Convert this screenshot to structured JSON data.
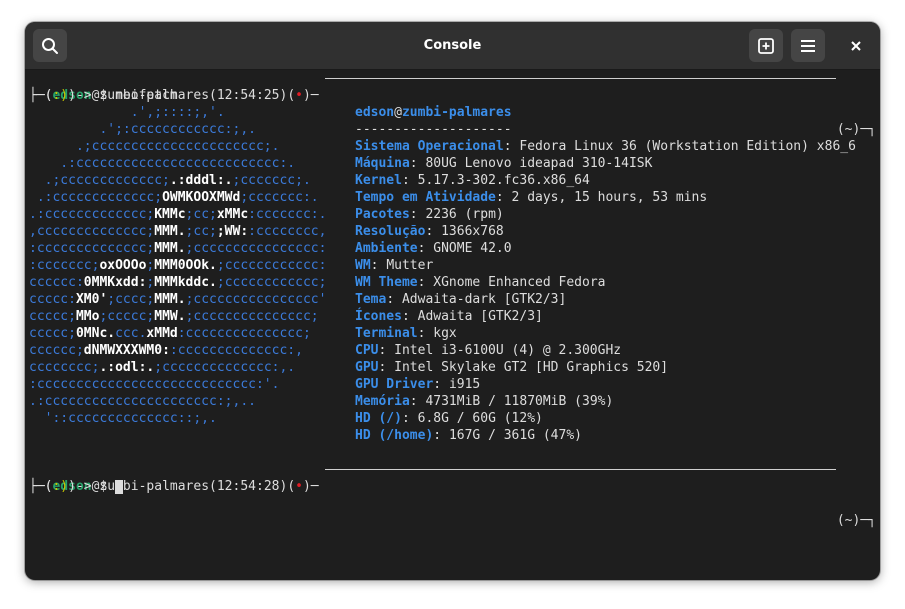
{
  "window": {
    "title": "Console",
    "icons": {
      "search": "search-icon",
      "new_tab": "new-tab-icon",
      "menu": "hamburger-menu-icon",
      "close": "close-icon"
    }
  },
  "prompts": [
    {
      "user": "edson",
      "at": "@",
      "host": "zumbi-palmares",
      "time": "(12:54:25)",
      "status_dot": "•",
      "right": "(~)",
      "smiley_open": "(",
      "smiley": ":)",
      "smiley_close": ")",
      "arrow": "-> $ ",
      "command": "neofetch"
    },
    {
      "user": "edson",
      "at": "@",
      "host": "zumbi-palmares",
      "time": "(12:54:28)",
      "status_dot": "•",
      "right": "(~)",
      "smiley_open": "(",
      "smiley": ":)",
      "smiley_close": ")",
      "arrow": "-> $ ",
      "command": ""
    }
  ],
  "ascii_art": [
    [
      [
        "b",
        "             .',;::::;,'."
      ]
    ],
    [
      [
        "b",
        "         .';:cccccccccccc:;,."
      ]
    ],
    [
      [
        "b",
        "      .;cccccccccccccccccccccc;."
      ]
    ],
    [
      [
        "b",
        "    .:cccccccccccccccccccccccccc:."
      ]
    ],
    [
      [
        "b",
        "  .;ccccccccccccc;"
      ],
      [
        "w",
        ".:dddl:."
      ],
      [
        "b",
        ";ccccccc;."
      ]
    ],
    [
      [
        "b",
        " .:ccccccccccccc;"
      ],
      [
        "w",
        "OWMKOOXMWd"
      ],
      [
        "b",
        ";ccccccc:."
      ]
    ],
    [
      [
        "b",
        ".:ccccccccccccc;"
      ],
      [
        "w",
        "KMMc"
      ],
      [
        "b",
        ";cc;"
      ],
      [
        "w",
        "xMMc"
      ],
      [
        "b",
        ":ccccccc:."
      ]
    ],
    [
      [
        "b",
        ",cccccccccccccc;"
      ],
      [
        "w",
        "MMM."
      ],
      [
        "b",
        ";cc;"
      ],
      [
        "w",
        ";WW:"
      ],
      [
        "b",
        ":cccccccc,"
      ]
    ],
    [
      [
        "b",
        ":cccccccccccccc;"
      ],
      [
        "w",
        "MMM."
      ],
      [
        "b",
        ";cccccccccccccccc:"
      ]
    ],
    [
      [
        "b",
        ":ccccccc;"
      ],
      [
        "w",
        "oxOOOo"
      ],
      [
        "b",
        ";"
      ],
      [
        "w",
        "MMM0OOk."
      ],
      [
        "b",
        ";cccccccccccc:"
      ]
    ],
    [
      [
        "b",
        "cccccc:"
      ],
      [
        "w",
        "0MMKxdd:"
      ],
      [
        "b",
        ";"
      ],
      [
        "w",
        "MMMkddc."
      ],
      [
        "b",
        ";cccccccccccc;"
      ]
    ],
    [
      [
        "b",
        "ccccc:"
      ],
      [
        "w",
        "XM0'"
      ],
      [
        "b",
        ";cccc;"
      ],
      [
        "w",
        "MMM."
      ],
      [
        "b",
        ";cccccccccccccccc'"
      ]
    ],
    [
      [
        "b",
        "ccccc;"
      ],
      [
        "w",
        "MMo"
      ],
      [
        "b",
        ";ccccc;"
      ],
      [
        "w",
        "MMW."
      ],
      [
        "b",
        ";ccccccccccccccc;"
      ]
    ],
    [
      [
        "b",
        "ccccc;"
      ],
      [
        "w",
        "0MNc."
      ],
      [
        "b",
        "ccc."
      ],
      [
        "w",
        "xMMd"
      ],
      [
        "b",
        ":ccccccccccccccc;"
      ]
    ],
    [
      [
        "b",
        "cccccc;"
      ],
      [
        "w",
        "dNMWXXXWM0:"
      ],
      [
        "b",
        ":cccccccccccccc:,"
      ]
    ],
    [
      [
        "b",
        "cccccccc;"
      ],
      [
        "w",
        ".:odl:."
      ],
      [
        "b",
        ";cccccccccccccc:,."
      ]
    ],
    [
      [
        "b",
        ":cccccccccccccccccccccccccccc:'."
      ]
    ],
    [
      [
        "b",
        ".:cccccccccccccccccccccc:;,.."
      ]
    ],
    [
      [
        "b",
        "  '::cccccccccccccc::;,."
      ]
    ]
  ],
  "sysinfo": {
    "user": "edson",
    "at": "@",
    "host": "zumbi-palmares",
    "separator": "--------------------",
    "fields": [
      {
        "key": "Sistema Operacional",
        "value": "Fedora Linux 36 (Workstation Edition) x86_6"
      },
      {
        "key": "Máquina",
        "value": "80UG Lenovo ideapad 310-14ISK"
      },
      {
        "key": "Kernel",
        "value": "5.17.3-302.fc36.x86_64"
      },
      {
        "key": "Tempo em Atividade",
        "value": "2 days, 15 hours, 53 mins"
      },
      {
        "key": "Pacotes",
        "value": "2236 (rpm)"
      },
      {
        "key": "Resolução",
        "value": "1366x768"
      },
      {
        "key": "Ambiente",
        "value": "GNOME 42.0"
      },
      {
        "key": "WM",
        "value": "Mutter"
      },
      {
        "key": "WM Theme",
        "value": "XGnome Enhanced Fedora"
      },
      {
        "key": "Tema",
        "value": "Adwaita-dark [GTK2/3]"
      },
      {
        "key": "Ícones",
        "value": "Adwaita [GTK2/3]"
      },
      {
        "key": "Terminal",
        "value": "kgx"
      },
      {
        "key": "CPU",
        "value": "Intel i3-6100U (4) @ 2.300GHz"
      },
      {
        "key": "GPU",
        "value": "Intel Skylake GT2 [HD Graphics 520]"
      },
      {
        "key": "GPU Driver",
        "value": "i915"
      },
      {
        "key": "Memória",
        "value": "4731MiB / 11870MiB (39%)"
      },
      {
        "key": "HD (/)",
        "value": "6.8G / 60G (12%)"
      },
      {
        "key": "HD (/home)",
        "value": "167G / 361G (47%)"
      }
    ]
  },
  "colors": {
    "background": "#1e1e1e",
    "headerbar": "#303030",
    "blue": "#3b8eea",
    "green": "#26a269",
    "red": "#e01b24"
  }
}
